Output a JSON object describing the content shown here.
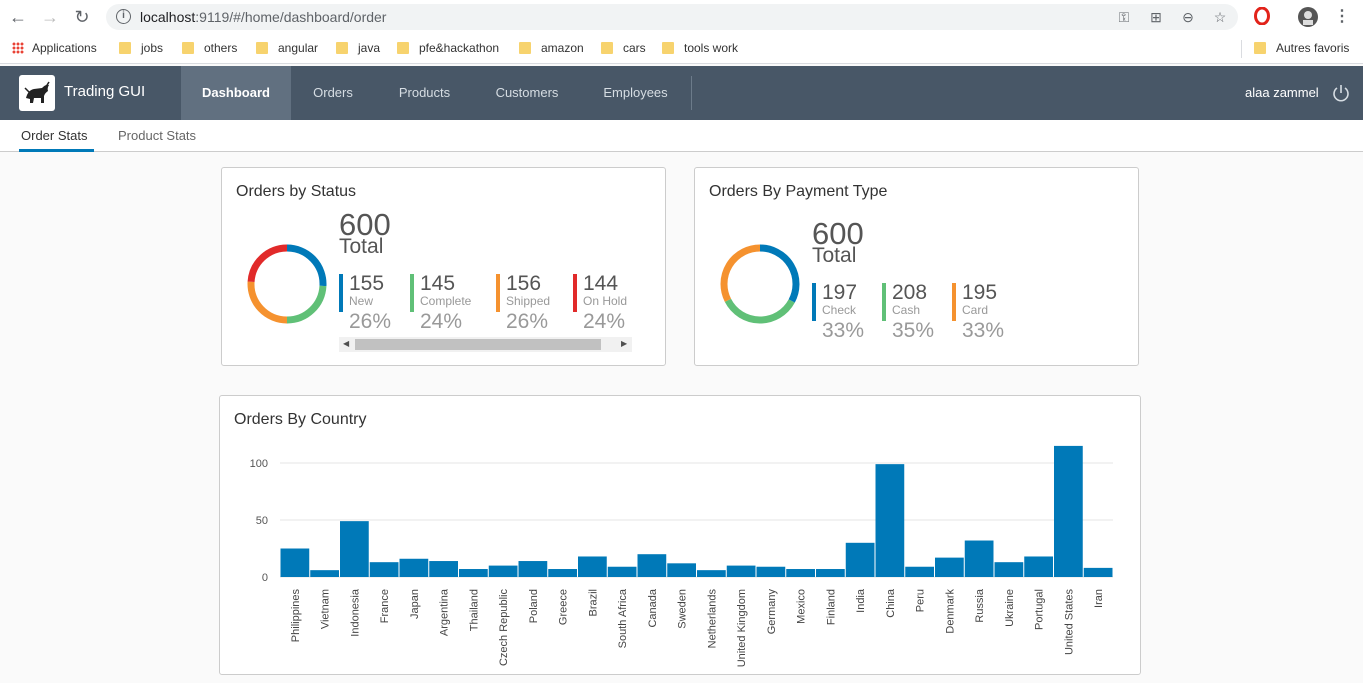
{
  "browser": {
    "url_host": "localhost",
    "url_rest": ":9119/#/home/dashboard/order",
    "bookmarks": [
      "Applications",
      "jobs",
      "others",
      "angular",
      "java",
      "pfe&hackathon",
      "amazon",
      "cars",
      "tools work"
    ],
    "other_bookmarks": "Autres favoris"
  },
  "header": {
    "brand": "Trading GUI",
    "nav": [
      "Dashboard",
      "Orders",
      "Products",
      "Customers",
      "Employees"
    ],
    "active_nav": "Dashboard",
    "user": "alaa zammel"
  },
  "subnav": {
    "tabs": [
      "Order Stats",
      "Product Stats"
    ],
    "active": "Order Stats"
  },
  "status_card": {
    "title": "Orders by Status",
    "total": "600",
    "total_label": "Total",
    "items": [
      {
        "value": "155",
        "label": "New",
        "pct": "26%",
        "color": "#0079b8"
      },
      {
        "value": "145",
        "label": "Complete",
        "pct": "24%",
        "color": "#60c077"
      },
      {
        "value": "156",
        "label": "Shipped",
        "pct": "26%",
        "color": "#f5922f"
      },
      {
        "value": "144",
        "label": "On Hold",
        "pct": "24%",
        "color": "#e12a2a"
      }
    ]
  },
  "payment_card": {
    "title": "Orders By Payment Type",
    "total": "600",
    "total_label": "Total",
    "items": [
      {
        "value": "197",
        "label": "Check",
        "pct": "33%",
        "color": "#0079b8"
      },
      {
        "value": "208",
        "label": "Cash",
        "pct": "35%",
        "color": "#60c077"
      },
      {
        "value": "195",
        "label": "Card",
        "pct": "33%",
        "color": "#f5922f"
      }
    ]
  },
  "chart_data": [
    {
      "type": "pie",
      "title": "Orders by Status",
      "categories": [
        "New",
        "Complete",
        "Shipped",
        "On Hold"
      ],
      "values": [
        155,
        145,
        156,
        144
      ],
      "colors": [
        "#0079b8",
        "#60c077",
        "#f5922f",
        "#e12a2a"
      ]
    },
    {
      "type": "pie",
      "title": "Orders By Payment Type",
      "categories": [
        "Check",
        "Cash",
        "Card"
      ],
      "values": [
        197,
        208,
        195
      ],
      "colors": [
        "#0079b8",
        "#60c077",
        "#f5922f"
      ]
    },
    {
      "type": "bar",
      "title": "Orders By Country",
      "categories": [
        "Philippines",
        "Vietnam",
        "Indonesia",
        "France",
        "Japan",
        "Argentina",
        "Thailand",
        "Czech Republic",
        "Poland",
        "Greece",
        "Brazil",
        "South Africa",
        "Canada",
        "Sweden",
        "Netherlands",
        "United Kingdom",
        "Germany",
        "Mexico",
        "Finland",
        "India",
        "China",
        "Peru",
        "Denmark",
        "Russia",
        "Ukraine",
        "Portugal",
        "United States",
        "Iran"
      ],
      "values": [
        25,
        6,
        49,
        13,
        16,
        14,
        7,
        10,
        14,
        7,
        18,
        9,
        20,
        12,
        6,
        10,
        9,
        7,
        7,
        30,
        99,
        9,
        17,
        32,
        13,
        18,
        115,
        8
      ],
      "yticks": [
        0,
        50,
        100
      ],
      "ylim": [
        0,
        120
      ],
      "color": "#0079b8"
    }
  ]
}
